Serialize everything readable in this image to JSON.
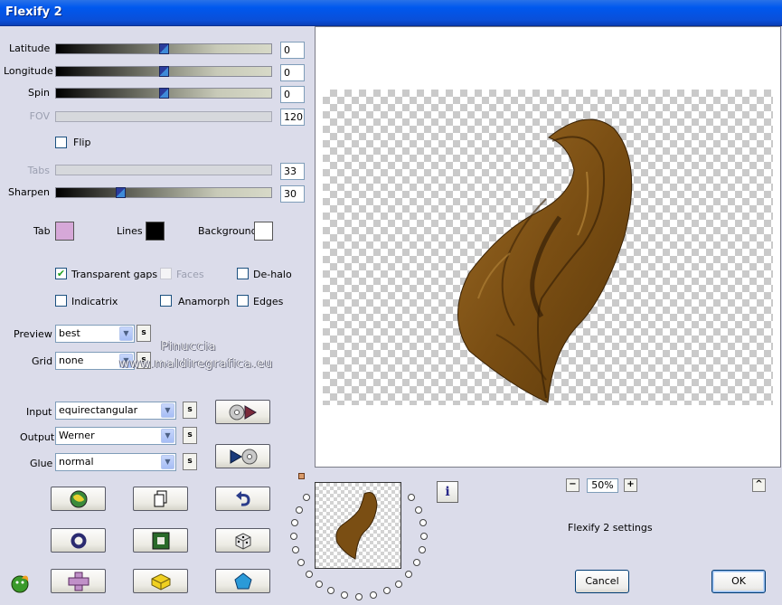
{
  "window": {
    "title": "Flexify 2"
  },
  "sliders": [
    {
      "label": "Latitude",
      "value": "0",
      "level": 0.5,
      "enabled": true
    },
    {
      "label": "Longitude",
      "value": "0",
      "level": 0.5,
      "enabled": true
    },
    {
      "label": "Spin",
      "value": "0",
      "level": 0.5,
      "enabled": true
    },
    {
      "label": "FOV",
      "value": "120",
      "enabled": false
    },
    {
      "label": "Tabs",
      "value": "33",
      "enabled": false
    },
    {
      "label": "Sharpen",
      "value": "30",
      "level": 0.3,
      "enabled": true
    }
  ],
  "flip": {
    "label": "Flip",
    "checked": false
  },
  "colors": {
    "tab": {
      "label": "Tab",
      "color": "#d6a8d8"
    },
    "lines": {
      "label": "Lines",
      "color": "#000000"
    },
    "background": {
      "label": "Background",
      "color": "#ffffff"
    }
  },
  "checkboxes": {
    "transparent_gaps": {
      "label": "Transparent gaps",
      "checked": true
    },
    "faces": {
      "label": "Faces",
      "checked": false,
      "enabled": false
    },
    "de_halo": {
      "label": "De-halo",
      "checked": false
    },
    "indicatrix": {
      "label": "Indicatrix",
      "checked": false
    },
    "anamorph": {
      "label": "Anamorph",
      "checked": false
    },
    "edges": {
      "label": "Edges",
      "checked": false
    }
  },
  "combos": {
    "preview": {
      "label": "Preview",
      "value": "best"
    },
    "grid": {
      "label": "Grid",
      "value": "none"
    },
    "input": {
      "label": "Input",
      "value": "equirectangular"
    },
    "output": {
      "label": "Output",
      "value": "Werner"
    },
    "glue": {
      "label": "Glue",
      "value": "normal"
    }
  },
  "small_button_label": "s",
  "watermark": {
    "line1": "Pinuccia",
    "line2": "www.maldiregrafica.eu"
  },
  "zoom": {
    "value": "50%",
    "minus": "−",
    "plus": "+"
  },
  "status": "Flexify 2 settings",
  "info_label": "i",
  "collapse_label": "^",
  "buttons": {
    "cancel": "Cancel",
    "ok": "OK"
  },
  "icons": {
    "play_from": "disc-play-icon",
    "play_to": "play-disc-icon",
    "random": "earth-icon",
    "copy": "document-icon",
    "undo": "undo-icon",
    "ring": "ring-icon",
    "square": "square-frame-icon",
    "dice": "dice-icon",
    "cross": "cross-icon",
    "cube": "cube-icon",
    "pentagon": "pentagon-icon",
    "logo": "flaming-face-logo-icon"
  }
}
